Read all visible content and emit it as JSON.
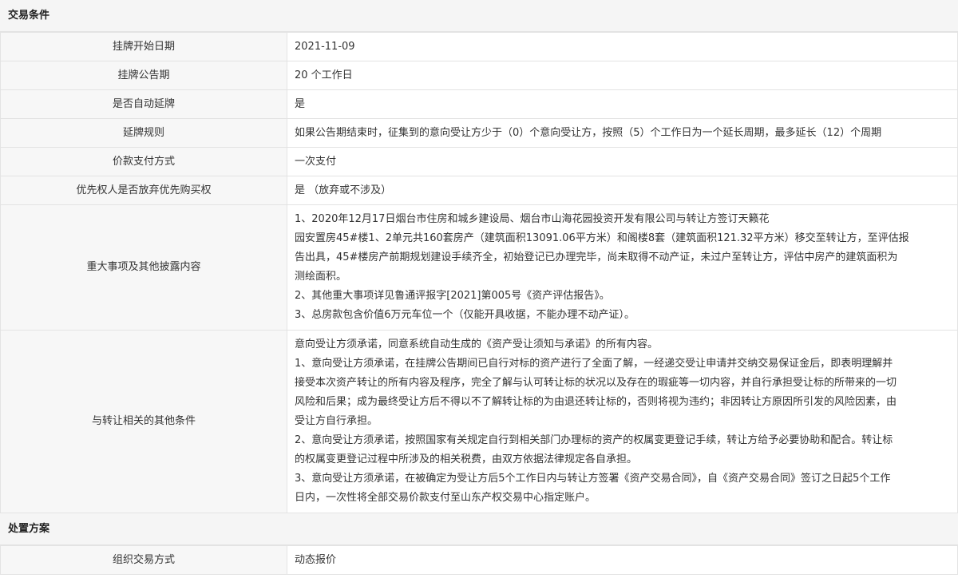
{
  "sections": {
    "trade_conditions": "交易条件",
    "disposal_plan": "处置方案"
  },
  "rows": {
    "listing_start_date": {
      "label": "挂牌开始日期",
      "value": "2021-11-09"
    },
    "listing_notice_period": {
      "label": "挂牌公告期",
      "value": "20 个工作日"
    },
    "auto_extend": {
      "label": "是否自动延牌",
      "value": "是"
    },
    "extend_rule": {
      "label": "延牌规则",
      "value": "如果公告期结束时，征集到的意向受让方少于（0）个意向受让方，按照（5）个工作日为一个延长周期，最多延长（12）个周期"
    },
    "payment_method": {
      "label": "价款支付方式",
      "value": "一次支付"
    },
    "preemptive_right": {
      "label": "优先权人是否放弃优先购买权",
      "value": "是 （放弃或不涉及）"
    },
    "major_matters": {
      "label": "重大事项及其他披露内容",
      "lines": [
        "1、2020年12月17日烟台市住房和城乡建设局、烟台市山海花园投资开发有限公司与转让方签订天籁花",
        "园安置房45#楼1、2单元共160套房产（建筑面积13091.06平方米）和阁楼8套（建筑面积121.32平方米）移交至转让方，至评估报",
        "告出具，45#楼房产前期规划建设手续齐全，初始登记已办理完毕，尚未取得不动产证，未过户至转让方，评估中房产的建筑面积为",
        "测绘面积。",
        "2、其他重大事项详见鲁通评报字[2021]第005号《资产评估报告》。",
        "3、总房款包含价值6万元车位一个（仅能开具收据，不能办理不动产证）。"
      ]
    },
    "other_conditions": {
      "label": "与转让相关的其他条件",
      "lines": [
        "意向受让方须承诺，同意系统自动生成的《资产受让须知与承诺》的所有内容。",
        "1、意向受让方须承诺，在挂牌公告期间已自行对标的资产进行了全面了解，一经递交受让申请并交纳交易保证金后，即表明理解并",
        "接受本次资产转让的所有内容及程序，完全了解与认可转让标的状况以及存在的瑕疵等一切内容，并自行承担受让标的所带来的一切",
        "风险和后果；成为最终受让方后不得以不了解转让标的为由退还转让标的，否则将视为违约；非因转让方原因所引发的风险因素，由",
        "受让方自行承担。",
        "2、意向受让方须承诺，按照国家有关规定自行到相关部门办理标的资产的权属变更登记手续，转让方给予必要协助和配合。转让标",
        "的权属变更登记过程中所涉及的相关税费，由双方依据法律规定各自承担。",
        "3、意向受让方须承诺，在被确定为受让方后5个工作日内与转让方签署《资产交易合同》，自《资产交易合同》签订之日起5个工作",
        "日内，一次性将全部交易价款支付至山东产权交易中心指定账户。"
      ]
    },
    "trade_method": {
      "label": "组织交易方式",
      "value": "动态报价"
    }
  }
}
